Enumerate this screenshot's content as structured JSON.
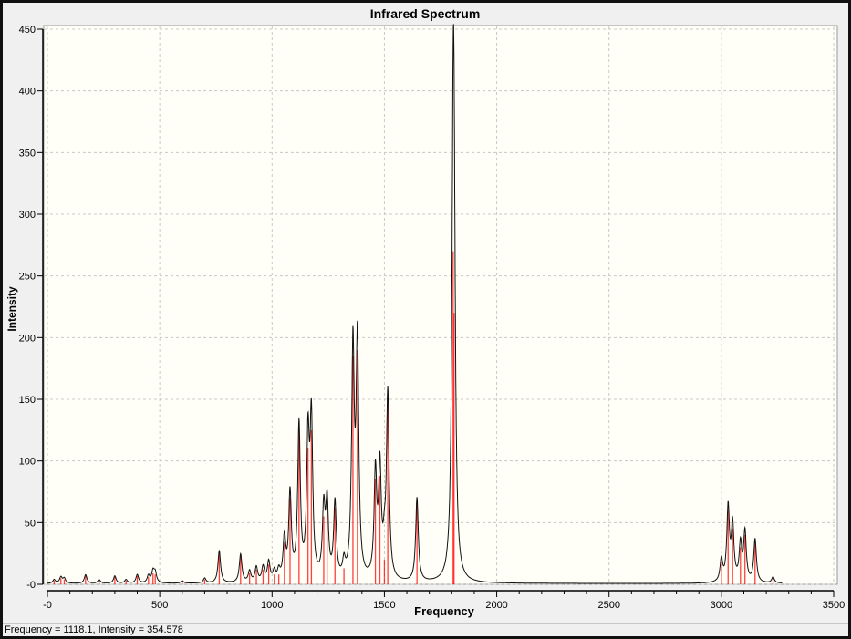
{
  "chart_data": {
    "type": "line",
    "title": "Infrared Spectrum",
    "xlabel": "Frequency",
    "ylabel": "Intensity",
    "xlim": [
      0,
      3500
    ],
    "ylim": [
      0,
      450
    ],
    "grid": true,
    "x_ticks": [
      0,
      500,
      1000,
      1500,
      2000,
      2500,
      3000,
      3500
    ],
    "x_tick_labels": [
      "-0",
      "500",
      "1000",
      "1500",
      "2000",
      "2500",
      "3000",
      "3500"
    ],
    "y_ticks": [
      0,
      50,
      100,
      150,
      200,
      250,
      300,
      350,
      400,
      450
    ],
    "y_tick_labels": [
      "-0",
      "50",
      "100",
      "150",
      "200",
      "250",
      "300",
      "350",
      "400",
      "450"
    ],
    "series": [
      {
        "name": "spectrum",
        "color": "#000000",
        "kind": "broadened envelope"
      },
      {
        "name": "sticks",
        "color": "#ff0000",
        "kind": "stick",
        "frequencies": [
          30,
          60,
          75,
          170,
          230,
          300,
          350,
          400,
          450,
          470,
          480,
          600,
          700,
          765,
          860,
          900,
          930,
          960,
          985,
          1010,
          1030,
          1055,
          1080,
          1120,
          1160,
          1175,
          1230,
          1245,
          1280,
          1320,
          1360,
          1380,
          1460,
          1480,
          1500,
          1515,
          1645,
          1806,
          1810,
          3000,
          3030,
          3050,
          3085,
          3105,
          3150,
          3230
        ],
        "intensities": [
          3,
          5,
          4,
          7,
          3,
          6,
          3,
          7,
          6,
          9,
          8,
          2,
          4,
          26,
          23,
          9,
          12,
          12,
          16,
          8,
          8,
          34,
          70,
          125,
          110,
          125,
          55,
          60,
          62,
          13,
          185,
          190,
          85,
          88,
          20,
          150,
          68,
          270,
          220,
          18,
          60,
          45,
          30,
          40,
          35,
          5
        ]
      }
    ]
  },
  "status": "Frequency = 1118.1,  Intensity = 354.578"
}
